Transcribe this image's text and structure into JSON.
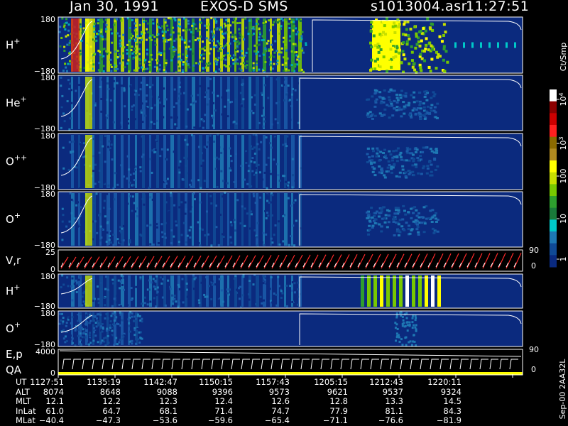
{
  "header": {
    "date": "Jan 30, 1991",
    "instrument": "EXOS-D SMS",
    "file": "s1013004.asr",
    "time": "11:27:51"
  },
  "panels": [
    {
      "id": "h-plus-1",
      "name": "H",
      "sup": "+",
      "ymax": "180",
      "ymin": "−180"
    },
    {
      "id": "he-plus",
      "name": "He",
      "sup": "+",
      "ymax": "180",
      "ymin": "−180"
    },
    {
      "id": "o-plusplus",
      "name": "O",
      "sup": "++",
      "ymax": "180",
      "ymin": "−180"
    },
    {
      "id": "o-plus-1",
      "name": "O",
      "sup": "+",
      "ymax": "180",
      "ymin": "−180"
    },
    {
      "id": "vr",
      "name": "V,r",
      "sup": "",
      "ymax": "25",
      "ymin": "0",
      "rmax": "90",
      "rmin": "0"
    },
    {
      "id": "h-plus-2",
      "name": "H",
      "sup": "+",
      "ymax": "180",
      "ymin": "−180"
    },
    {
      "id": "o-plus-2",
      "name": "O",
      "sup": "+",
      "ymax": "180",
      "ymin": "−180"
    },
    {
      "id": "ep-qa",
      "name": "E,p",
      "name2": "QA",
      "sup": "",
      "ymax": "4000",
      "ymin": "0",
      "rmax": "90",
      "rmin": "0"
    }
  ],
  "colorbar": {
    "unit": "Ct/Smp",
    "labels": [
      "10^4",
      "10^3",
      "100",
      "10",
      "1"
    ],
    "colors": [
      "#ffffff",
      "#8b0000",
      "#cc0000",
      "#ff2020",
      "#8b6a00",
      "#b08a20",
      "#ffff00",
      "#c8e000",
      "#78c800",
      "#2e9e2e",
      "#1a7a3a",
      "#00c8c8",
      "#1e78b4",
      "#104a96",
      "#0a2a80"
    ]
  },
  "footer_label": "Sep-00 2AA32L",
  "table": {
    "rows": [
      {
        "label": "UT",
        "values": [
          "1127:51",
          "1135:19",
          "1142:47",
          "1150:15",
          "1157:43",
          "1205:15",
          "1212:43",
          "1220:11"
        ]
      },
      {
        "label": "ALT",
        "values": [
          "8074",
          "8648",
          "9088",
          "9396",
          "9573",
          "9621",
          "9537",
          "9324"
        ]
      },
      {
        "label": "MLT",
        "values": [
          "12.1",
          "12.2",
          "12.3",
          "12.4",
          "12.6",
          "12.8",
          "13.3",
          "14.5"
        ]
      },
      {
        "label": "InLat",
        "values": [
          "61.0",
          "64.7",
          "68.1",
          "71.4",
          "74.7",
          "77.9",
          "81.1",
          "84.3"
        ]
      },
      {
        "label": "MLat",
        "values": [
          "−40.4",
          "−47.3",
          "−53.6",
          "−59.6",
          "−65.4",
          "−71.1",
          "−76.6",
          "−81.9"
        ]
      }
    ]
  }
}
